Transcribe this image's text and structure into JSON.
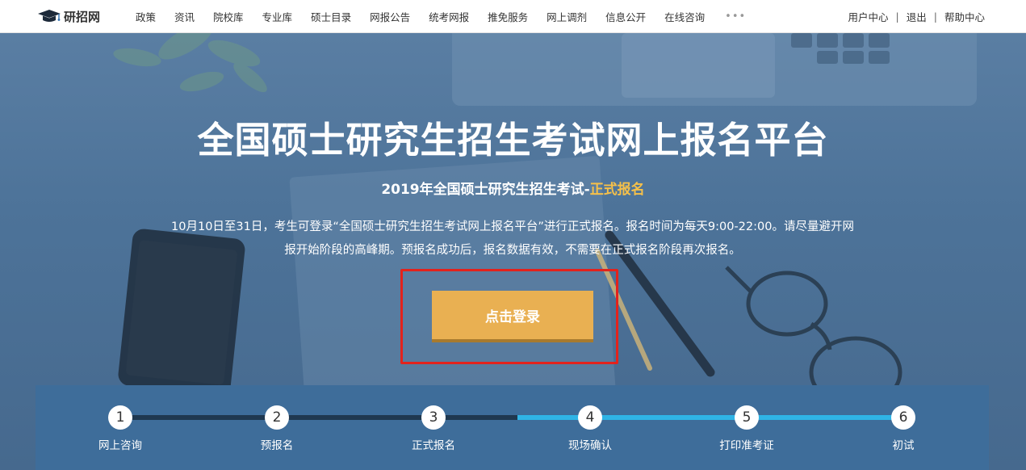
{
  "header": {
    "logo_text": "研招网",
    "nav": [
      "政策",
      "资讯",
      "院校库",
      "专业库",
      "硕士目录",
      "网报公告",
      "统考网报",
      "推免服务",
      "网上调剂",
      "信息公开",
      "在线咨询"
    ],
    "more": "•••",
    "user_links": [
      "用户中心",
      "退出",
      "帮助中心"
    ],
    "separator": "|"
  },
  "hero": {
    "title": "全国硕士研究生招生考试网上报名平台",
    "subtitle_main": "2019年全国硕士研究生招生考试-",
    "subtitle_highlight": "正式报名",
    "description_line1": "10月10日至31日，考生可登录“全国硕士研究生招生考试网上报名平台”进行正式报名。报名时间为每天9:00-22:00。请尽量避开网",
    "description_line2": "报开始阶段的高峰期。预报名成功后，报名数据有效，不需要在正式报名阶段再次报名。",
    "login_button": "点击登录"
  },
  "steps": [
    {
      "num": "1",
      "label": "网上咨询"
    },
    {
      "num": "2",
      "label": "预报名"
    },
    {
      "num": "3",
      "label": "正式报名"
    },
    {
      "num": "4",
      "label": "现场确认"
    },
    {
      "num": "5",
      "label": "打印准考证"
    },
    {
      "num": "6",
      "label": "初试"
    }
  ],
  "colors": {
    "highlight": "#f5c04a",
    "login_button": "#e9b052",
    "annotation_frame": "#e3221c",
    "track_done": "#1f3850",
    "track_todo": "#2fb4e6"
  }
}
